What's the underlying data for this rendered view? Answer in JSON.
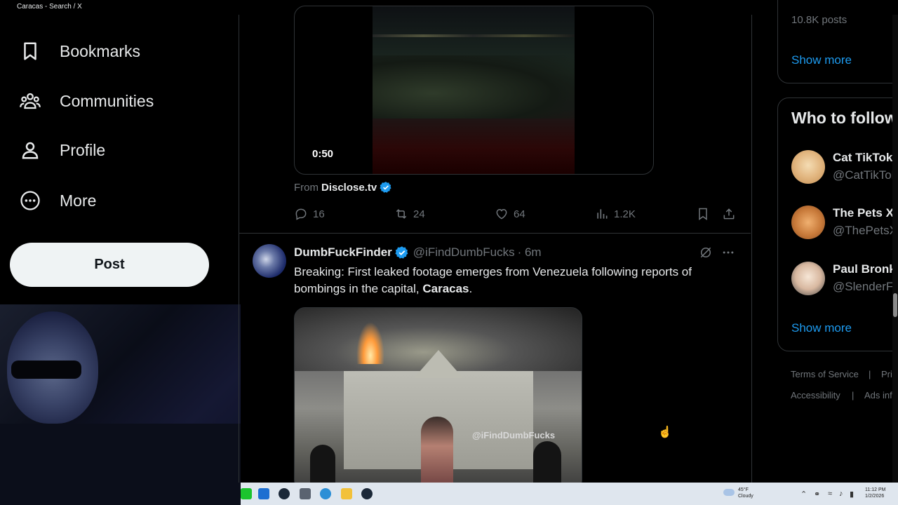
{
  "window": {
    "title": "Caracas - Search / X",
    "controls": [
      "•••",
      "—",
      "❐",
      "✕"
    ]
  },
  "nav": {
    "items": [
      {
        "label": "Bookmarks"
      },
      {
        "label": "Communities"
      },
      {
        "label": "Profile"
      },
      {
        "label": "More"
      }
    ],
    "post_label": "Post"
  },
  "video_post": {
    "duration": "0:50",
    "from_prefix": "From",
    "source": "Disclose.tv",
    "actions": {
      "replies": "16",
      "reposts": "24",
      "likes": "64",
      "views": "1.2K"
    }
  },
  "tweet": {
    "name": "DumbFuckFinder",
    "handle": "@iFindDumbFucks",
    "time": "· 6m",
    "text_before": "Breaking: First leaked footage emerges from Venezuela following reports of bombings in the capital, ",
    "text_bold": "Caracas",
    "text_after": ".",
    "image_watermark": "@iFindDumbFucks"
  },
  "sidebar": {
    "trend_posts": "10.8K posts",
    "show_more_1": "Show more",
    "who_to_follow_title": "Who to follow",
    "accounts": [
      {
        "name": "Cat TikTok",
        "handle": "@CatTikTok"
      },
      {
        "name": "The Pets X",
        "handle": "@ThePetsX"
      },
      {
        "name": "Paul Bronks",
        "handle": "@SlenderFerb"
      }
    ],
    "show_more_2": "Show more",
    "footer": {
      "terms": "Terms of Service",
      "sep1": "|",
      "privacy": "Privacy Policy",
      "accessibility": "Accessibility",
      "sep2": "|",
      "ads": "Ads info"
    }
  },
  "taskbar": {
    "weather_temp": "45°F",
    "weather_desc": "Cloudy",
    "time": "11:12 PM",
    "date": "1/2/2026"
  },
  "colors": {
    "accent": "#1d9bf0",
    "background": "#000000",
    "border": "#2f3336",
    "muted": "#71767b",
    "text": "#e7e9ea"
  }
}
